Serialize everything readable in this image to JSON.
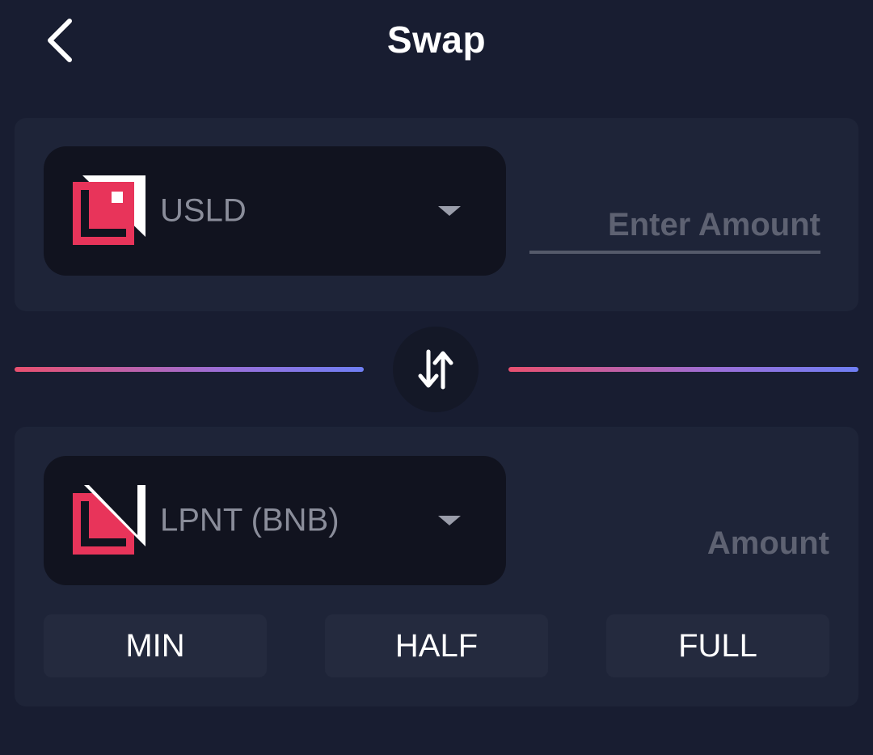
{
  "header": {
    "title": "Swap",
    "back_icon": "chevron-left-icon"
  },
  "from": {
    "token": "USLD",
    "token_icon": "usld-logo-icon",
    "amount_placeholder": "Enter Amount",
    "amount_value": ""
  },
  "swap": {
    "icon": "swap-arrows-icon"
  },
  "to": {
    "token": "LPNT (BNB)",
    "token_icon": "lpnt-logo-icon",
    "amount_placeholder": "Amount",
    "amount_value": ""
  },
  "quick_amounts": {
    "min": "MIN",
    "half": "HALF",
    "full": "FULL"
  },
  "colors": {
    "background": "#181d31",
    "card": "#1e2438",
    "token_select": "#11131f",
    "brand_red": "#e8345a",
    "gradient_start": "#e8506f",
    "gradient_end": "#6f7ff4"
  }
}
